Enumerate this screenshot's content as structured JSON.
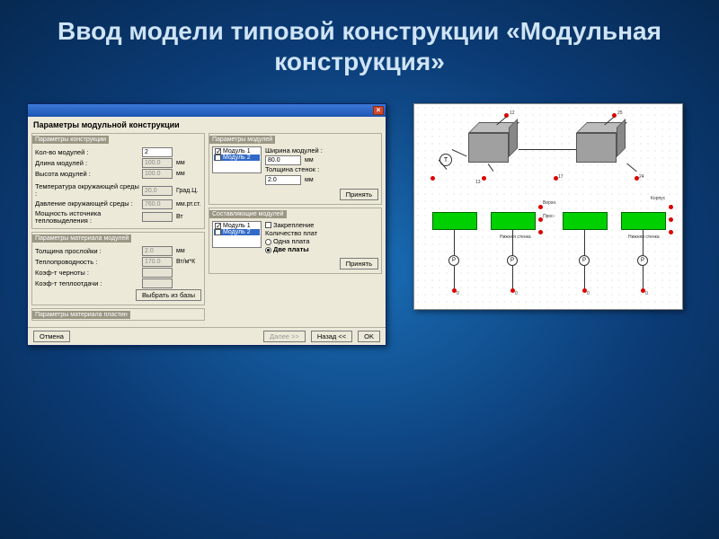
{
  "slide_title": "Ввод модели типовой конструкции «Модульная конструкция»",
  "dialog": {
    "title": "Параметры модульной конструкции",
    "groups": {
      "construction": "Параметры конструкции",
      "material": "Параметры материала модулей",
      "plates_material": "Параметры материала пластин",
      "modules": "Параметры модулей",
      "components": "Составляющие модулей"
    },
    "fields": {
      "count": {
        "label": "Кол-во модулей :",
        "value": "2",
        "unit": ""
      },
      "length": {
        "label": "Длина модулей :",
        "value": "100.0",
        "unit": "мм"
      },
      "height": {
        "label": "Высота модулей :",
        "value": "100.0",
        "unit": "мм"
      },
      "temp": {
        "label": "Температура окружающей среды :",
        "value": "20.0",
        "unit": "Град.Ц."
      },
      "pressure": {
        "label": "Давление окружающей среды :",
        "value": "760.0",
        "unit": "мм.рт.ст."
      },
      "power": {
        "label": "Мощность источника тепловыделения :",
        "value": "",
        "unit": "Вт"
      },
      "layer": {
        "label": "Толщина прослойки :",
        "value": "2.0",
        "unit": "мм"
      },
      "conduct": {
        "label": "Теплопроводность :",
        "value": "170.0",
        "unit": "Вт/м*К"
      },
      "black": {
        "label": "Коэф-т черноты :",
        "value": "",
        "unit": ""
      },
      "heat": {
        "label": "Коэф-т теплоотдачи :",
        "value": "",
        "unit": ""
      },
      "width": {
        "label": "Ширина модулей :",
        "value": "80.0",
        "unit": "мм"
      },
      "wall": {
        "label": "Толщина стенок :",
        "value": "2.0",
        "unit": "мм"
      }
    },
    "list1": {
      "items": [
        "Модуль 1",
        "Модуль 2"
      ],
      "selected": 1
    },
    "list2": {
      "items": [
        "Модуль 1",
        "Модуль 2"
      ],
      "selected": 1
    },
    "zakr": "Закрепление",
    "plates_count": "Количество плат",
    "radio1": "Одна плата",
    "radio2": "Две платы",
    "select_base": "Выбрать из базы",
    "buttons": {
      "apply": "Принять",
      "cancel": "Отмена",
      "next": "Далее >>",
      "back": "Назад <<",
      "ok": "OK"
    }
  },
  "diagram": {
    "t_label": "T",
    "p_label": "P",
    "num_tl1": "12",
    "num_tr1": "25",
    "num_bl1": "13",
    "num_tr2": "17",
    "num_br2": "24",
    "lbl_top": "Верхн.",
    "lbl_pros": "Прос-",
    "lbl_bot": "Нижняя стенка",
    "lbl_kor": "Корпус"
  }
}
